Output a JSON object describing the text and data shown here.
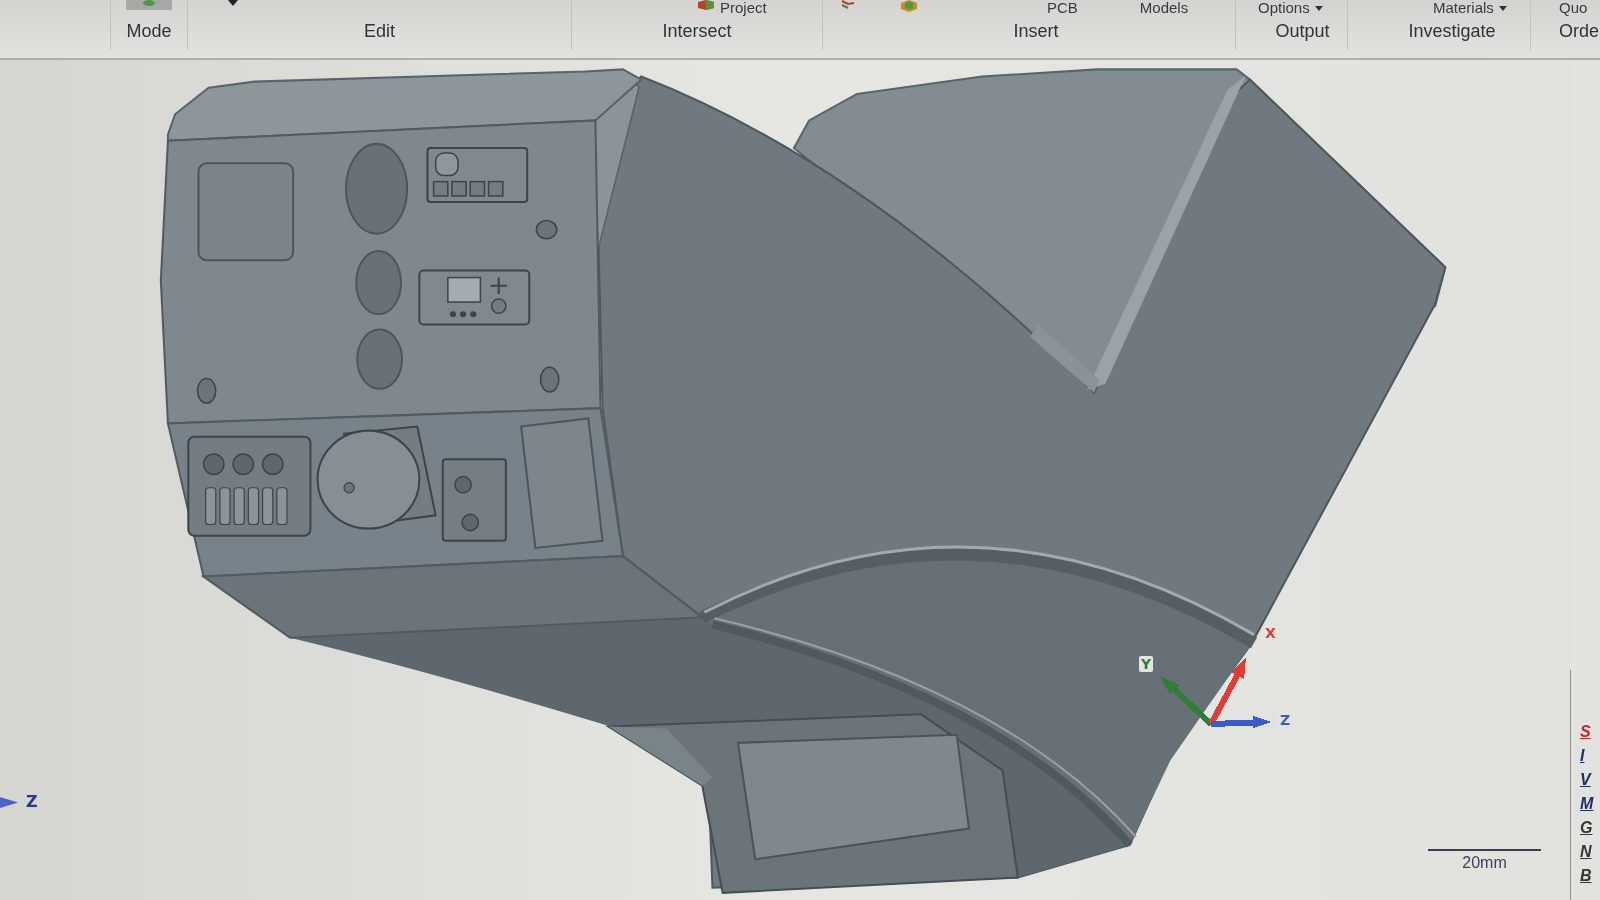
{
  "ribbon": {
    "groups": [
      {
        "label": "Mode"
      },
      {
        "label": "Edit"
      },
      {
        "label": "Intersect",
        "tools": [
          {
            "label": "Project",
            "dropdown": false
          }
        ]
      },
      {
        "label": "Insert",
        "tools": [
          {
            "label": "PCB",
            "dropdown": false
          },
          {
            "label": "Models",
            "dropdown": false
          }
        ]
      },
      {
        "label": "Output",
        "tools": [
          {
            "label": "Options",
            "dropdown": true
          }
        ]
      },
      {
        "label": "Investigate",
        "tools": [
          {
            "label": "Materials",
            "dropdown": true
          }
        ]
      },
      {
        "label": "Orde",
        "tools": [
          {
            "label": "Quo",
            "dropdown": false
          }
        ]
      }
    ]
  },
  "viewport": {
    "axis_triad": [
      {
        "label": "Y",
        "color": "#2f7d3a"
      },
      {
        "label": "X",
        "color": "#e23b33"
      },
      {
        "label": "Z",
        "color": "#3b5bc8"
      }
    ],
    "view_axis": {
      "label": "Z"
    },
    "scale_bar": {
      "label": "20mm"
    }
  },
  "side_panel": {
    "links": [
      {
        "label": "S",
        "color": "#c62828"
      },
      {
        "label": "I",
        "color": "#1f2d6b"
      },
      {
        "label": "V",
        "color": "#1f2d6b"
      },
      {
        "label": "M",
        "color": "#1f2d6b"
      },
      {
        "label": "G",
        "color": "#2e3a33"
      },
      {
        "label": "N",
        "color": "#2e3a33"
      },
      {
        "label": "B",
        "color": "#2e3a33"
      }
    ]
  }
}
